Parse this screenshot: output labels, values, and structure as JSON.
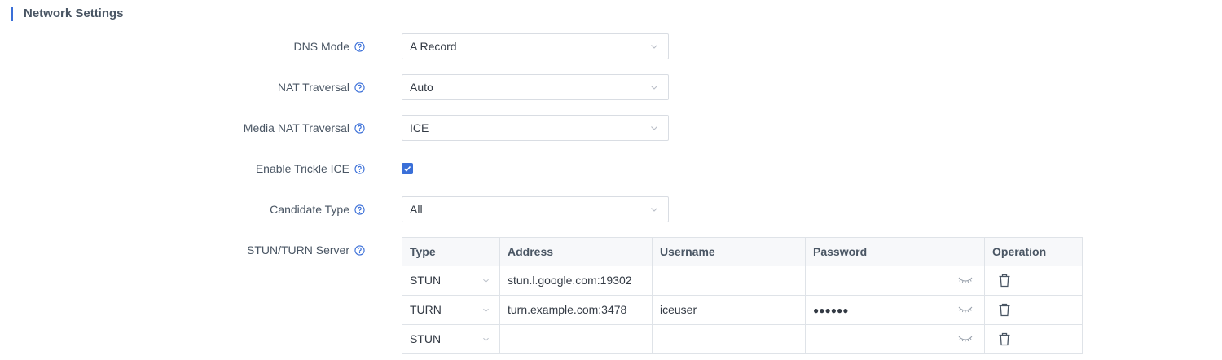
{
  "section": {
    "title": "Network Settings"
  },
  "fields": {
    "dns_mode": {
      "label": "DNS Mode",
      "value": "A Record"
    },
    "nat_traversal": {
      "label": "NAT Traversal",
      "value": "Auto"
    },
    "media_nat_traversal": {
      "label": "Media NAT Traversal",
      "value": "ICE"
    },
    "enable_trickle_ice": {
      "label": "Enable Trickle ICE",
      "checked": true
    },
    "candidate_type": {
      "label": "Candidate Type",
      "value": "All"
    },
    "stun_turn": {
      "label": "STUN/TURN Server"
    }
  },
  "table": {
    "headers": [
      "Type",
      "Address",
      "Username",
      "Password",
      "Operation"
    ],
    "rows": [
      {
        "type": "STUN",
        "address": "stun.l.google.com:19302",
        "username": "",
        "password": ""
      },
      {
        "type": "TURN",
        "address": "turn.example.com:3478",
        "username": "iceuser",
        "password": "●●●●●●"
      },
      {
        "type": "STUN",
        "address": "",
        "username": "",
        "password": ""
      }
    ]
  },
  "colors": {
    "accent": "#3a6fd8",
    "border": "#d9dde3",
    "header_bg": "#f7f8fa"
  },
  "icons": {
    "help": "help-circle-icon",
    "chevron": "chevron-down-icon",
    "eye": "eye-closed-icon",
    "trash": "trash-icon"
  }
}
